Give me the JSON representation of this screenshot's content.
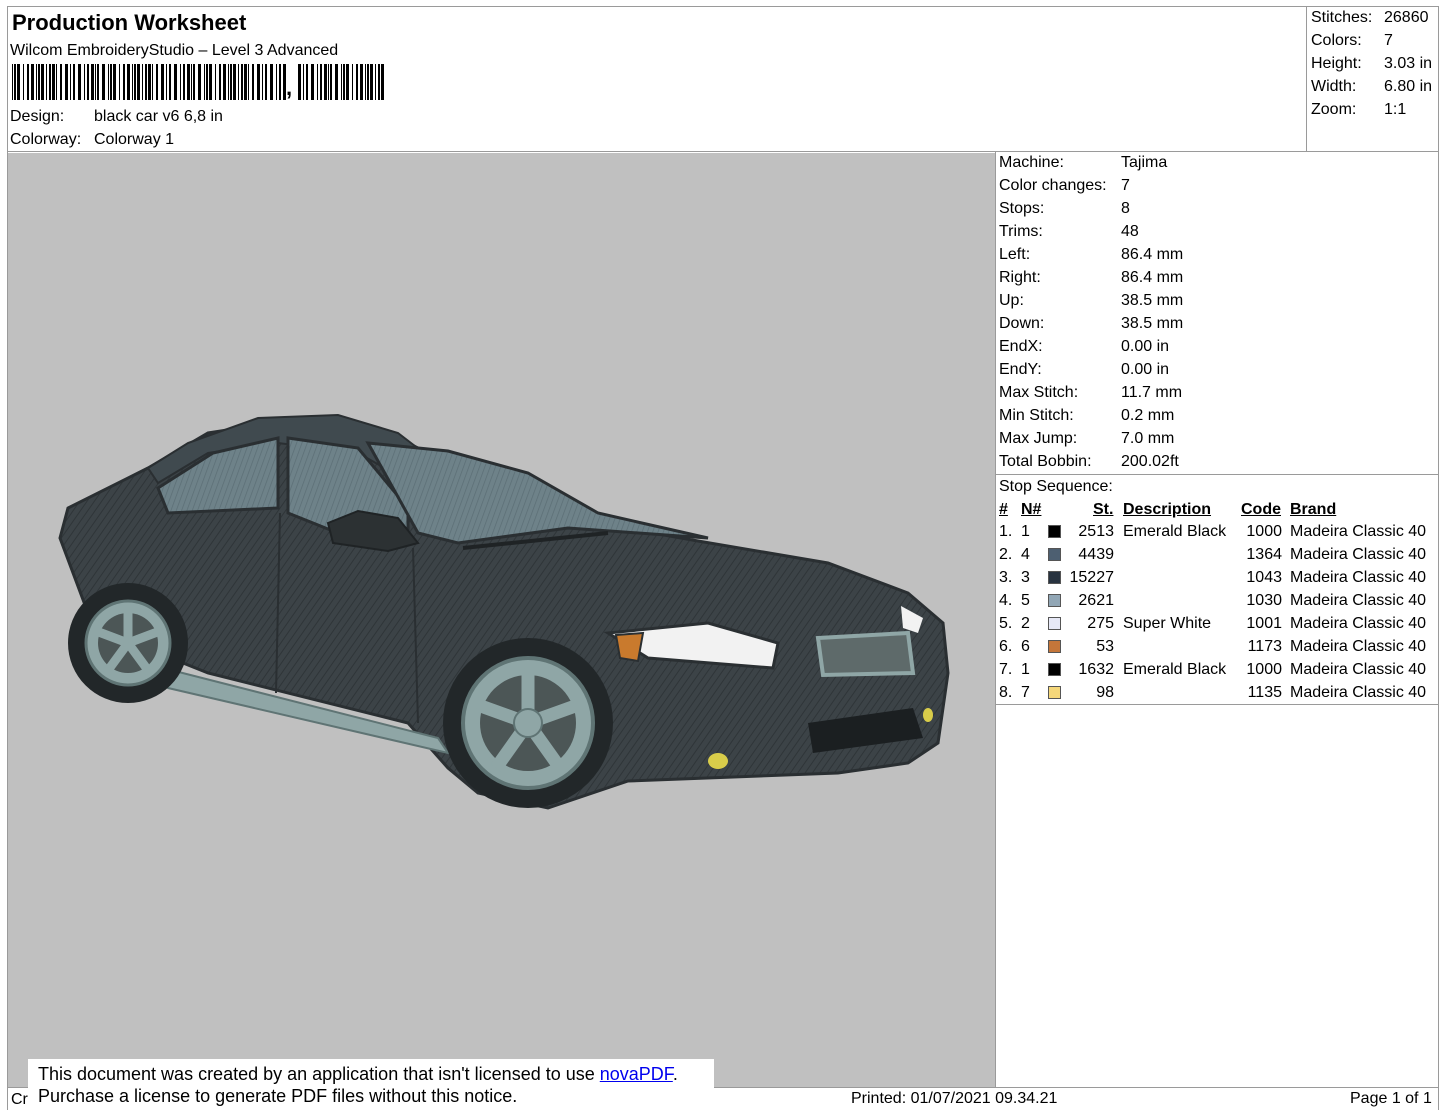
{
  "header": {
    "title": "Production Worksheet",
    "software": "Wilcom EmbroideryStudio – Level 3 Advanced",
    "barcode_suffix": ",",
    "design_label": "Design:",
    "design_value": "black car v6 6,8 in",
    "colorway_label": "Colorway:",
    "colorway_value": "Colorway 1"
  },
  "summary": [
    {
      "label": "Stitches:",
      "value": "26860"
    },
    {
      "label": "Colors:",
      "value": "7"
    },
    {
      "label": "Height:",
      "value": "3.03 in"
    },
    {
      "label": "Width:",
      "value": "6.80 in"
    },
    {
      "label": "Zoom:",
      "value": "1:1"
    }
  ],
  "details": [
    {
      "label": "Machine:",
      "value": "Tajima"
    },
    {
      "label": "Color changes:",
      "value": "7"
    },
    {
      "label": "Stops:",
      "value": "8"
    },
    {
      "label": "Trims:",
      "value": "48"
    },
    {
      "label": "Left:",
      "value": "86.4 mm"
    },
    {
      "label": "Right:",
      "value": "86.4 mm"
    },
    {
      "label": "Up:",
      "value": "38.5 mm"
    },
    {
      "label": "Down:",
      "value": "38.5 mm"
    },
    {
      "label": "EndX:",
      "value": "0.00 in"
    },
    {
      "label": "EndY:",
      "value": "0.00 in"
    },
    {
      "label": "Max Stitch:",
      "value": "11.7 mm"
    },
    {
      "label": "Min Stitch:",
      "value": "0.2 mm"
    },
    {
      "label": "Max Jump:",
      "value": "7.0 mm"
    },
    {
      "label": "Total Bobbin:",
      "value": "200.02ft"
    }
  ],
  "stop_sequence": {
    "title": "Stop Sequence:",
    "columns": {
      "idx": "#",
      "n": "N#",
      "st": "St.",
      "desc": "Description",
      "code": "Code",
      "brand": "Brand"
    },
    "rows": [
      {
        "idx": "1.",
        "n": "1",
        "color": "#000000",
        "st": "2513",
        "desc": "Emerald Black",
        "code": "1000",
        "brand": "Madeira Classic 40"
      },
      {
        "idx": "2.",
        "n": "4",
        "color": "#4d5f71",
        "st": "4439",
        "desc": "",
        "code": "1364",
        "brand": "Madeira Classic 40"
      },
      {
        "idx": "3.",
        "n": "3",
        "color": "#283340",
        "st": "15227",
        "desc": "",
        "code": "1043",
        "brand": "Madeira Classic 40"
      },
      {
        "idx": "4.",
        "n": "5",
        "color": "#91a6b5",
        "st": "2621",
        "desc": "",
        "code": "1030",
        "brand": "Madeira Classic 40"
      },
      {
        "idx": "5.",
        "n": "2",
        "color": "#e6e8f6",
        "st": "275",
        "desc": "Super White",
        "code": "1001",
        "brand": "Madeira Classic 40"
      },
      {
        "idx": "6.",
        "n": "6",
        "color": "#c4763a",
        "st": "53",
        "desc": "",
        "code": "1173",
        "brand": "Madeira Classic 40"
      },
      {
        "idx": "7.",
        "n": "1",
        "color": "#000000",
        "st": "1632",
        "desc": "Emerald Black",
        "code": "1000",
        "brand": "Madeira Classic 40"
      },
      {
        "idx": "8.",
        "n": "7",
        "color": "#f5d77a",
        "st": "98",
        "desc": "",
        "code": "1135",
        "brand": "Madeira Classic 40"
      }
    ]
  },
  "footer": {
    "left_fragment": "Cr",
    "notice_line1": "This document was created by an application that isn't licensed to use ",
    "notice_link": "novaPDF",
    "notice_period": ".",
    "notice_line2": "Purchase a license to generate PDF files without this notice.",
    "printed": "Printed: 01/07/2021 09.34.21",
    "page": "Page 1 of 1"
  },
  "colors": {
    "background": "#c0c0c0",
    "car_body": "#3c4347",
    "wheel": "#8fa6a6",
    "glass": "#6e8289",
    "headlight": "#f2f2f2",
    "indicator": "#c97a2d",
    "foglight": "#d9cd4a"
  }
}
